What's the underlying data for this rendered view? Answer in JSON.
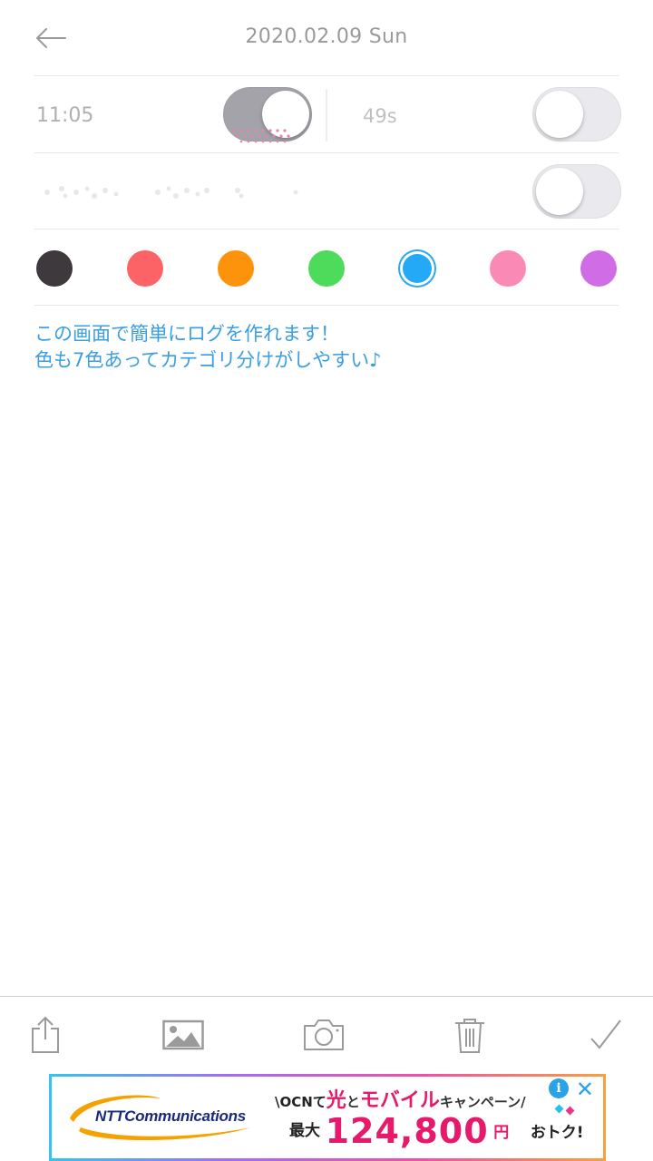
{
  "header": {
    "title": "2020.02.09 Sun",
    "back_icon": "back-arrow-icon"
  },
  "timer": {
    "time_label": "11:05",
    "time_toggle_on": true,
    "seconds_label": "49s",
    "seconds_toggle_on": false
  },
  "option_row": {
    "toggle_on": false
  },
  "colors": [
    {
      "name": "black",
      "hex": "#3d393c",
      "selected": false
    },
    {
      "name": "red",
      "hex": "#fb6366",
      "selected": false
    },
    {
      "name": "orange",
      "hex": "#fd930b",
      "selected": false
    },
    {
      "name": "green",
      "hex": "#4ddb5c",
      "selected": false
    },
    {
      "name": "blue",
      "hex": "#23a9f6",
      "selected": true
    },
    {
      "name": "pink",
      "hex": "#fb89b6",
      "selected": false
    },
    {
      "name": "purple",
      "hex": "#d06de6",
      "selected": false
    }
  ],
  "note": {
    "text": "この画面で簡単にログを作れます！\n色も7色あってカテゴリ分けがしやすい♪"
  },
  "toolbar": {
    "share_icon": "share-icon",
    "image_icon": "image-icon",
    "camera_icon": "camera-icon",
    "trash_icon": "trash-icon",
    "check_icon": "check-icon"
  },
  "ad": {
    "brand": "NTTCommunications",
    "headline_prefix": "\\OCNて",
    "headline_hikari": "光",
    "headline_to": "と",
    "headline_mobile": "モバイル",
    "headline_campaign": "キャンペーン/",
    "line2_prefix": "最大",
    "amount": "124,800",
    "yen": "円",
    "line2_suffix": "おトク!",
    "info_icon": "i",
    "close_icon": "✕"
  }
}
